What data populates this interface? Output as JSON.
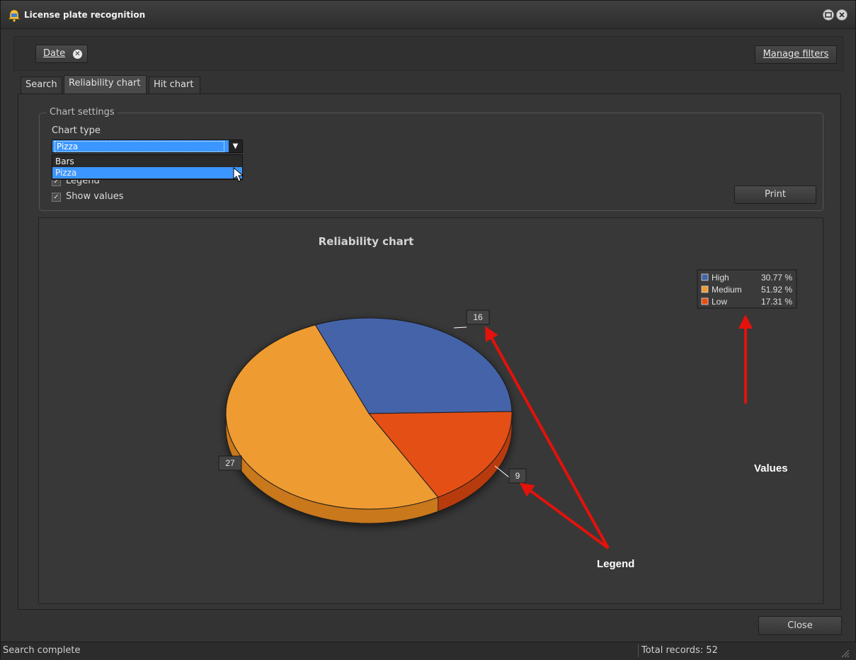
{
  "window": {
    "title": "License plate recognition",
    "icon": "bell-camera-icon"
  },
  "filters": {
    "chips": [
      {
        "label": "Date"
      }
    ],
    "manage_label": "Manage filters"
  },
  "tabs": [
    {
      "label": "Search",
      "active": false
    },
    {
      "label": "Reliability chart",
      "active": true
    },
    {
      "label": "Hit chart",
      "active": false
    }
  ],
  "settings": {
    "group_label": "Chart settings",
    "chart_type_label": "Chart type",
    "chart_type_value": "Pizza",
    "dropdown_options": [
      "Bars",
      "Pizza"
    ],
    "legend_label": "Legend",
    "legend_checked": true,
    "show_values_label": "Show values",
    "show_values_checked": true,
    "print_label": "Print"
  },
  "chart_data": {
    "type": "pie",
    "title": "Reliability chart",
    "categories": [
      "High",
      "Medium",
      "Low"
    ],
    "values": [
      16,
      27,
      9
    ],
    "percentages": [
      "30.77 %",
      "51.92 %",
      "17.31 %"
    ],
    "colors": [
      "#4464a8",
      "#ee9b33",
      "#e44f14"
    ],
    "side_colors": [
      "#2f4a80",
      "#c9781c",
      "#b83a0c"
    ],
    "legend_placement": "top-right"
  },
  "annotations": {
    "values_label": "Values",
    "legend_label": "Legend",
    "arrow_color": "#e3120b"
  },
  "footer": {
    "close_label": "Close",
    "status": "Search complete",
    "total_records": "Total records: 52"
  }
}
